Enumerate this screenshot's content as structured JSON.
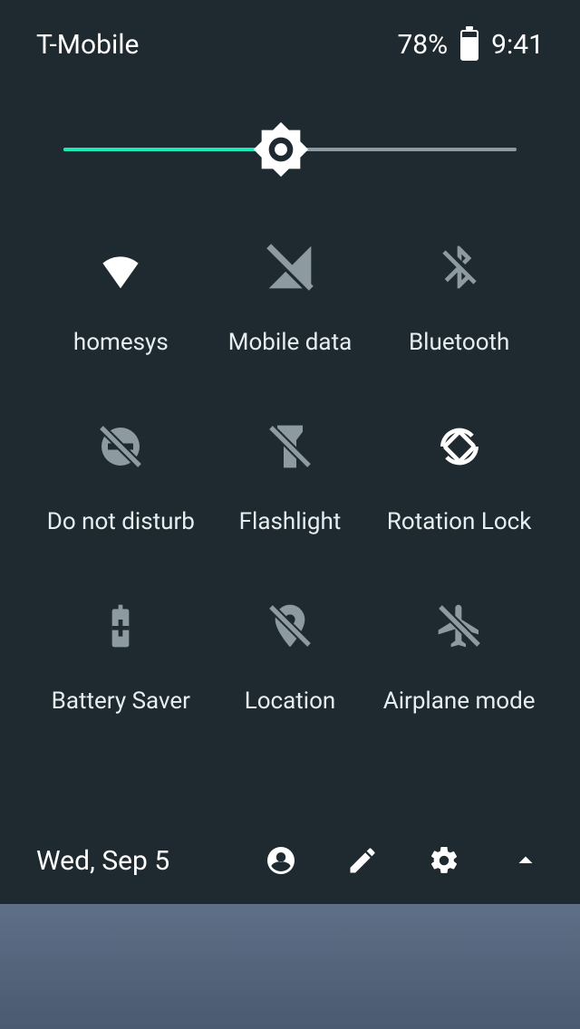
{
  "status": {
    "carrier": "T-Mobile",
    "battery_text": "78%",
    "battery_level": 78,
    "time": "9:41"
  },
  "brightness": {
    "percent": 48
  },
  "tiles": [
    {
      "id": "wifi",
      "label": "homesys",
      "active": true
    },
    {
      "id": "mobile-data",
      "label": "Mobile data",
      "active": false
    },
    {
      "id": "bluetooth",
      "label": "Bluetooth",
      "active": false
    },
    {
      "id": "dnd",
      "label": "Do not disturb",
      "active": false
    },
    {
      "id": "flashlight",
      "label": "Flashlight",
      "active": false
    },
    {
      "id": "rotation",
      "label": "Rotation Lock",
      "active": true
    },
    {
      "id": "battery-saver",
      "label": "Battery Saver",
      "active": false
    },
    {
      "id": "location",
      "label": "Location",
      "active": false
    },
    {
      "id": "airplane",
      "label": "Airplane mode",
      "active": false
    }
  ],
  "footer": {
    "date": "Wed, Sep 5"
  },
  "colors": {
    "panel_bg": "#1f2a30",
    "accent": "#1de9b6",
    "inactive": "#8d9a9f"
  }
}
